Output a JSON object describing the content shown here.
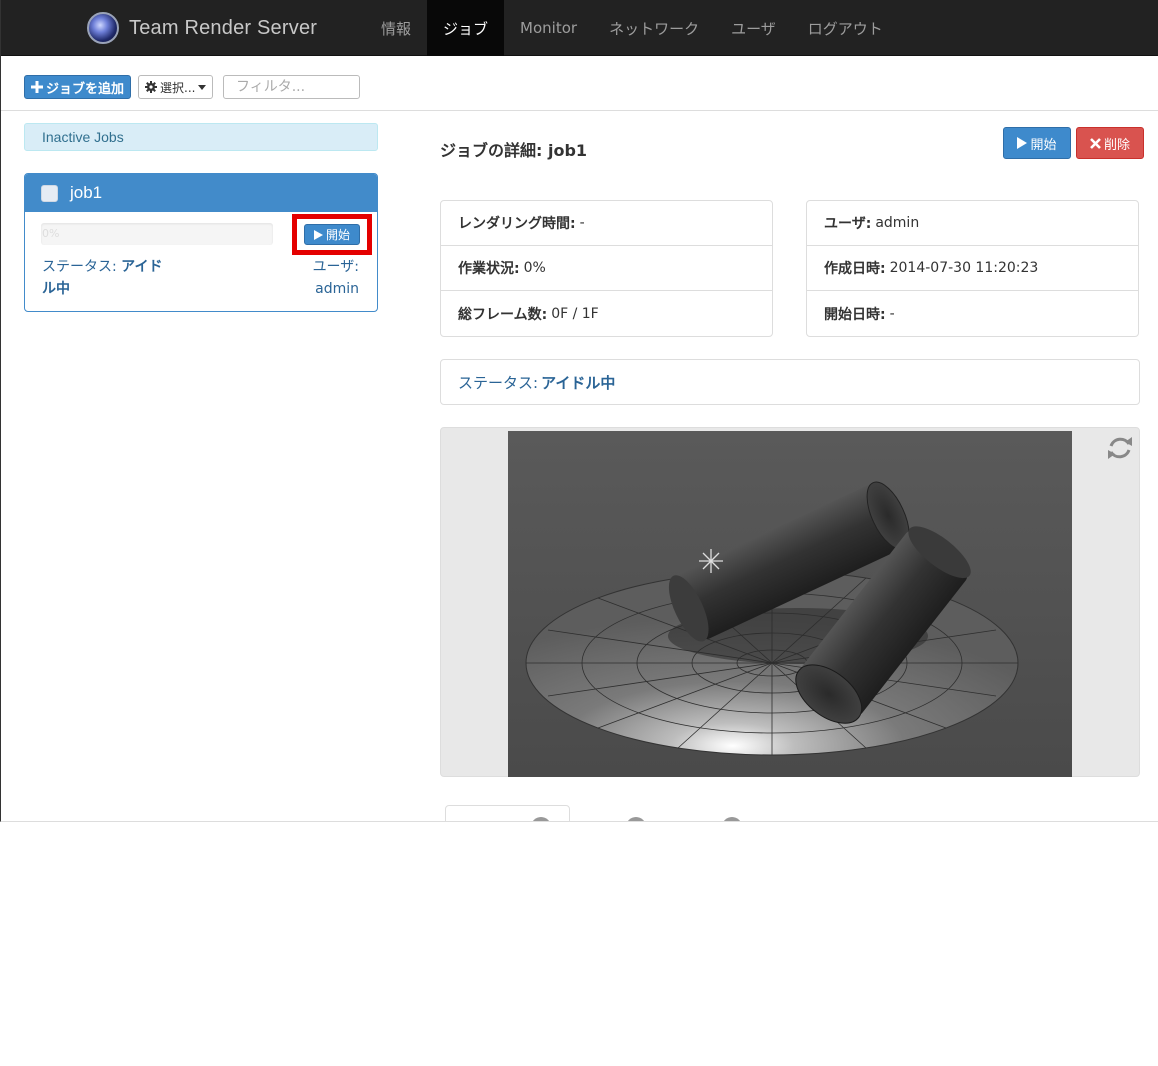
{
  "navbar": {
    "brand": "Team Render Server",
    "items": [
      {
        "label": "情報",
        "active": false
      },
      {
        "label": "ジョブ",
        "active": true
      },
      {
        "label": "Monitor",
        "active": false
      },
      {
        "label": "ネットワーク",
        "active": false
      },
      {
        "label": "ユーザ",
        "active": false
      },
      {
        "label": "ログアウト",
        "active": false
      }
    ]
  },
  "toolbar": {
    "add_job_label": "ジョブを追加",
    "select_label": "選択...",
    "filter_placeholder": "フィルタ..."
  },
  "jobs": {
    "section_title": "Inactive Jobs",
    "items": [
      {
        "name": "job1",
        "progress_text": "0%",
        "progress": 0,
        "start_label": "開始",
        "status_label": "ステータス:",
        "status_value": "アイドル中",
        "user_label": "ユーザ:",
        "user_value": "admin"
      }
    ]
  },
  "detail": {
    "title": "ジョブの詳細: job1",
    "start_label": "開始",
    "delete_label": "削除",
    "left": [
      {
        "label": "レンダリング時間:",
        "value": "-"
      },
      {
        "label": "作業状況:",
        "value": "0%"
      },
      {
        "label": "総フレーム数:",
        "value": "0F / 1F"
      }
    ],
    "right": [
      {
        "label": "ユーザ:",
        "value": "admin"
      },
      {
        "label": "作成日時:",
        "value": "2014-07-30 11:20:23"
      },
      {
        "label": "開始日時:",
        "value": "-"
      }
    ],
    "status_label": "ステータス:",
    "status_value": "アイドル中"
  },
  "colors": {
    "navbar_bg": "#222222",
    "primary": "#428bca",
    "danger": "#d9534f",
    "link": "#2a6496",
    "highlight": "#e40000"
  },
  "icons": [
    "cinema4d-logo-icon",
    "plus-icon",
    "gear-icon",
    "caret-down-icon",
    "play-icon",
    "close-icon",
    "refresh-icon"
  ]
}
